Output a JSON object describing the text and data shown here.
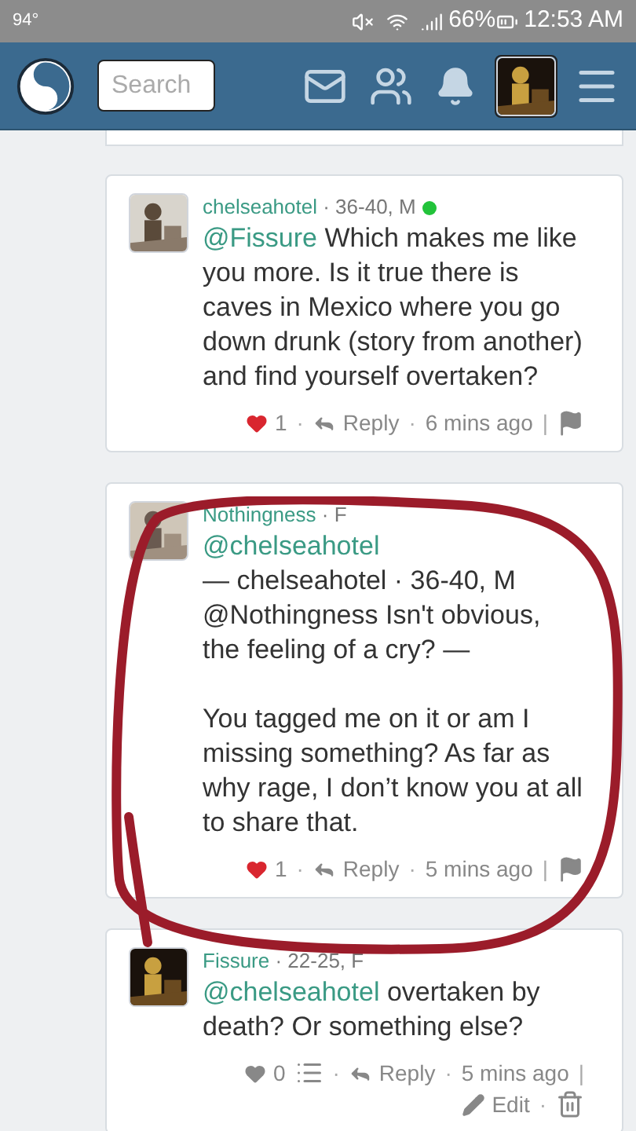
{
  "status_bar": {
    "temperature": "94°",
    "battery": "66%",
    "time": "12:53 AM"
  },
  "header": {
    "search": {
      "placeholder": "Search"
    }
  },
  "comments": [
    {
      "author": "chelseahotel",
      "meta": " · 36-40, M",
      "online": true,
      "body": [
        {
          "kind": "mention",
          "text": "@Fissure"
        },
        {
          "kind": "text",
          "text": " Which makes me like you more. Is it true there is caves in Mexico where you go down drunk (story from another) and find yourself overtaken?"
        }
      ],
      "footer": [
        {
          "kind": "like",
          "text": "1",
          "liked": true
        },
        {
          "kind": "sep",
          "text": "·"
        },
        {
          "kind": "reply",
          "text": "Reply"
        },
        {
          "kind": "sep",
          "text": "·"
        },
        {
          "kind": "time",
          "text": "6 mins ago"
        },
        {
          "kind": "sep",
          "text": "|"
        },
        {
          "kind": "flag"
        }
      ]
    },
    {
      "author": "Nothingness",
      "meta": " · F",
      "online": false,
      "body": [
        {
          "kind": "mention",
          "text": "@chelseahotel"
        },
        {
          "kind": "text",
          "text": "\n— chelseahotel · 36-40, M\n@Nothingness Isn't obvious, the feeling of a cry? —\n\nYou tagged me on it or am I missing something? As far as why rage, I don’t know you at all to share that."
        }
      ],
      "footer": [
        {
          "kind": "like",
          "text": "1",
          "liked": true
        },
        {
          "kind": "sep",
          "text": "·"
        },
        {
          "kind": "reply",
          "text": "Reply"
        },
        {
          "kind": "sep",
          "text": "·"
        },
        {
          "kind": "time",
          "text": "5 mins ago"
        },
        {
          "kind": "sep",
          "text": "|"
        },
        {
          "kind": "flag"
        }
      ]
    },
    {
      "author": "Fissure",
      "meta": " · 22-25, F",
      "online": false,
      "body": [
        {
          "kind": "mention",
          "text": "@chelseahotel"
        },
        {
          "kind": "text",
          "text": " overtaken by death? Or something else?"
        }
      ],
      "footer": [
        {
          "kind": "like",
          "text": "0",
          "liked": false
        },
        {
          "kind": "list"
        },
        {
          "kind": "sep",
          "text": "·"
        },
        {
          "kind": "reply",
          "text": "Reply"
        },
        {
          "kind": "sep",
          "text": "·"
        },
        {
          "kind": "time",
          "text": "5 mins ago"
        },
        {
          "kind": "sep",
          "text": "|"
        },
        {
          "kind": "edit",
          "text": "Edit"
        },
        {
          "kind": "sep",
          "text": "·"
        },
        {
          "kind": "delete"
        }
      ]
    }
  ]
}
